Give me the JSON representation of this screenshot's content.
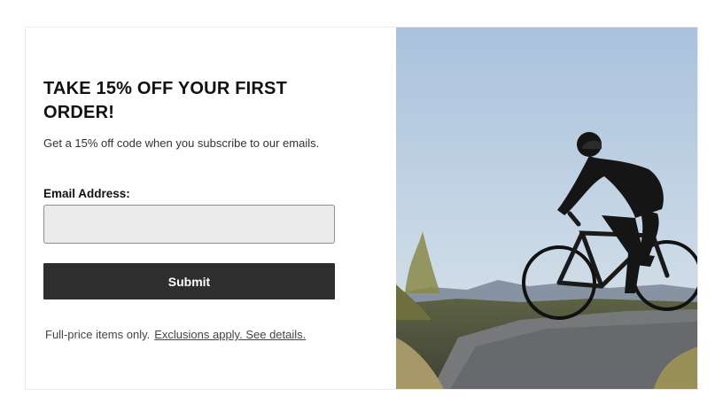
{
  "signup": {
    "headline": "TAKE 15% OFF YOUR FIRST ORDER!",
    "subtext": "Get a 15% off code when you subscribe to our emails.",
    "email_label": "Email Address:",
    "email_value": "",
    "submit_label": "Submit",
    "footnote_text": "Full-price items only.",
    "footnote_link": "Exclusions apply. See details."
  },
  "hero_image": {
    "subject": "cyclist-on-gravel-bike"
  },
  "colors": {
    "button_bg": "#2e2e2e",
    "input_bg": "#ebebeb",
    "sky": "#b8cde0"
  }
}
